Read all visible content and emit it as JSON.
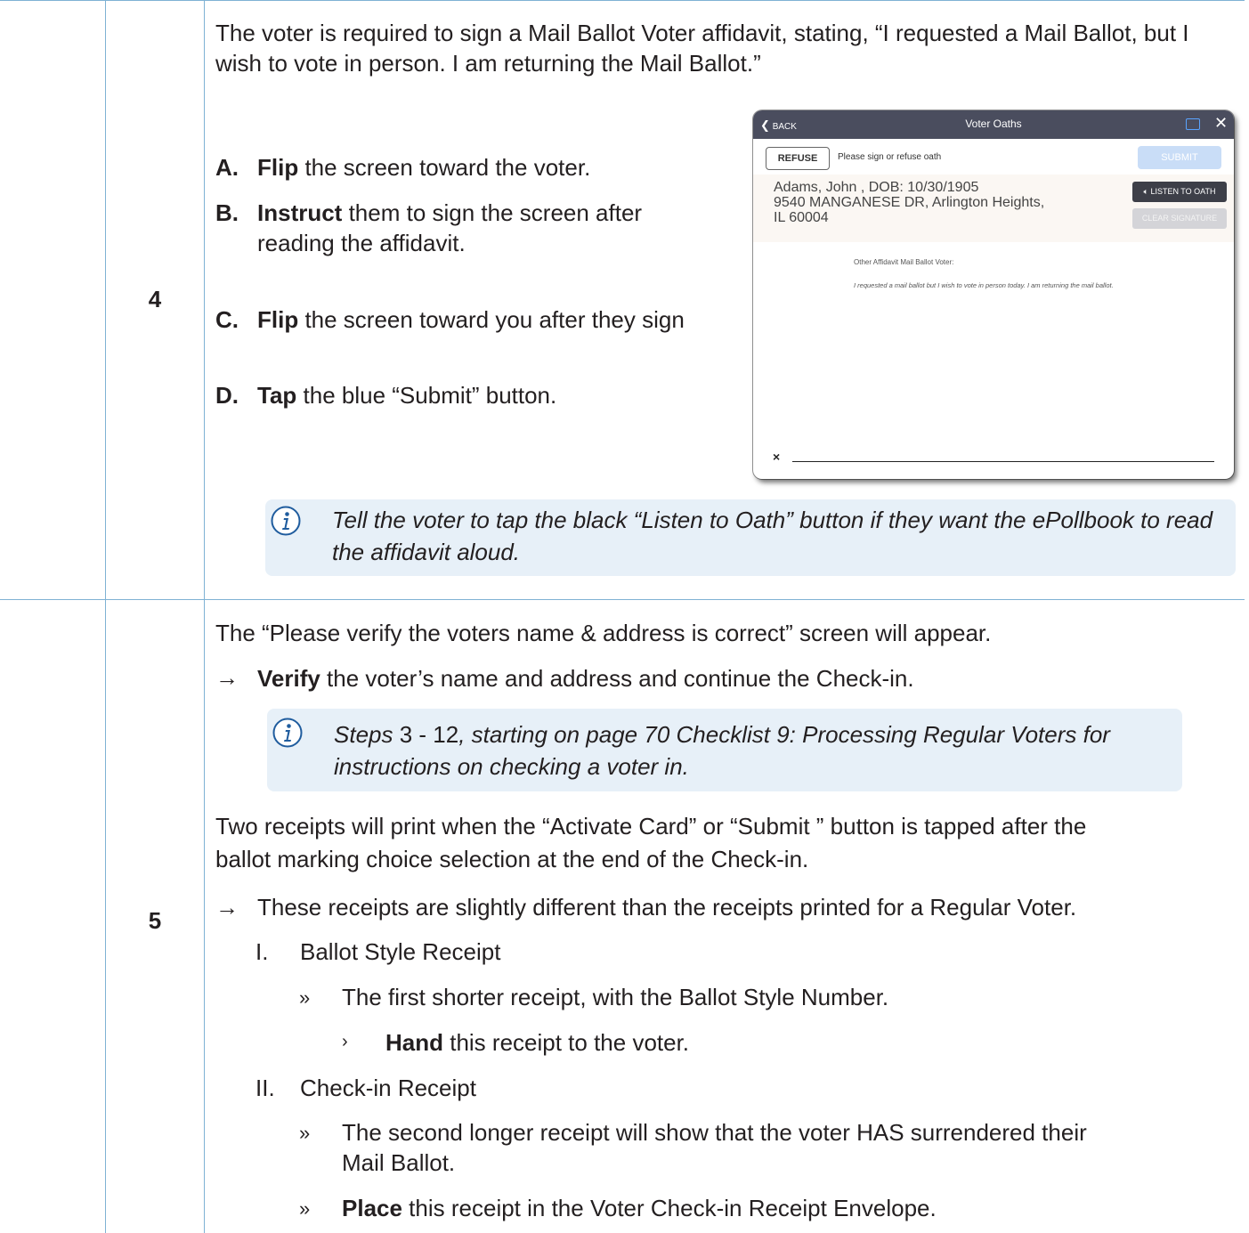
{
  "step4": {
    "number": "4",
    "intro": "The voter is required to sign a Mail Ballot Voter affidavit, stating, “I requested a Mail Ballot, but I wish to vote in person.  I am returning the Mail Ballot.”",
    "steps": [
      {
        "letter": "A.",
        "action": "Flip",
        "rest": " the screen toward the voter."
      },
      {
        "letter": "B.",
        "action": "Instruct",
        "rest": " them to sign the screen after reading the affidavit."
      },
      {
        "letter": "C.",
        "action": "Flip",
        "rest": " the screen toward you after they sign"
      },
      {
        "letter": "D.",
        "action": "Tap",
        "rest": " the blue “Submit” button."
      }
    ],
    "note": "Tell the voter to tap the black “Listen to Oath” button if they want the ePollbook to read the affidavit aloud."
  },
  "screenshot": {
    "back": "BACK",
    "title": "Voter Oaths",
    "close": "✕",
    "refuse": "REFUSE",
    "prompt": "Please sign or refuse oath",
    "submit": "SUBMIT",
    "voter_line1": "Adams, John , DOB: 10/30/1905",
    "voter_line2": "9540 MANGANESE DR, Arlington Heights,",
    "voter_line3": "IL 60004",
    "listen": "LISTEN TO OATH",
    "clear": "CLEAR SIGNATURE",
    "affidavit_label": "Other Affidavit Mail Ballot Voter:",
    "affidavit_text": "I requested a mail ballot but I wish to vote in person today.  I am returning the mail ballot.",
    "sign_x": "×"
  },
  "step5": {
    "number": "5",
    "intro": "The “Please verify the voters name & address is correct” screen will appear.",
    "verify_action": "Verify",
    "verify_rest": " the voter’s name and address and continue the Check-in.",
    "note_steps": "Steps",
    "note_range": " 3 - 12",
    "note_rest_1": ", starting on page 70 Checklist 9: Processing Regular Voters for",
    "note_rest_2": "instructions on checking a voter in.",
    "receipts_line1": "Two receipts will print when the “Activate Card” or “Submit ” button is tapped after the",
    "receipts_line2": "ballot marking choice selection at the end of the Check-in.",
    "diff": "These receipts are slightly different than the receipts printed for a Regular Voter.",
    "r1_num": "I.",
    "r1_title": "Ballot Style Receipt",
    "r1_desc": "The first shorter receipt, with the Ballot Style Number.",
    "r1_action": "Hand",
    "r1_action_rest": " this receipt to the voter.",
    "r2_num": "II.",
    "r2_title": "Check-in Receipt",
    "r2_desc_1": "The second longer receipt will show that the voter HAS surrendered their",
    "r2_desc_2": "Mail Ballot.",
    "r2_action": "Place",
    "r2_action_rest": " this receipt in the Voter Check-in Receipt Envelope."
  }
}
